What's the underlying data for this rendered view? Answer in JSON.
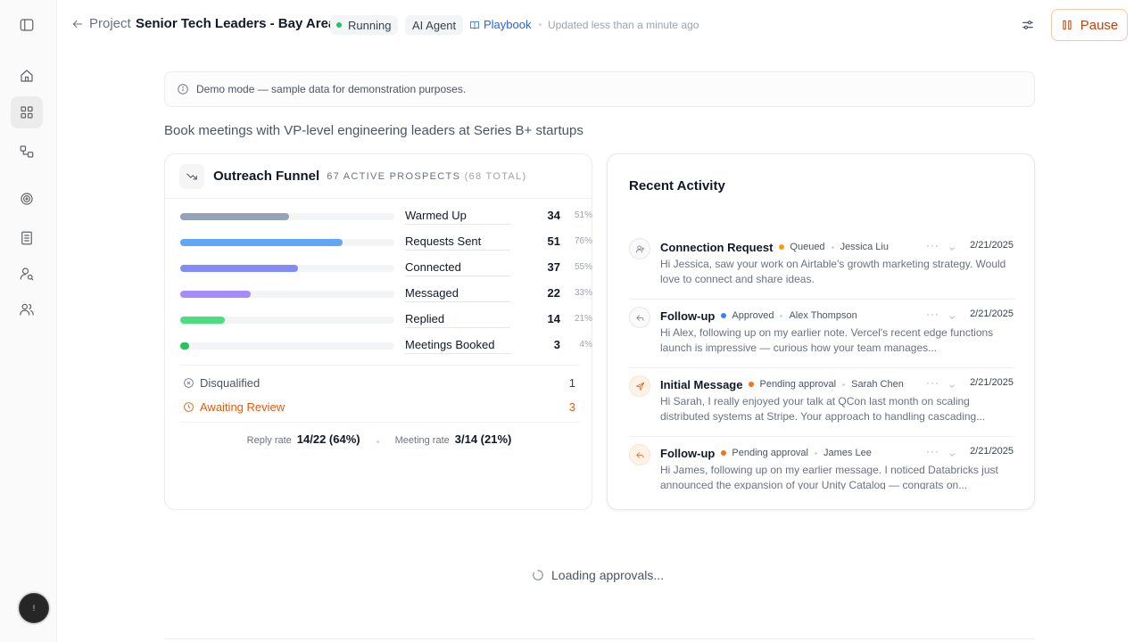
{
  "sidebar": {
    "icons": [
      "panel-toggle-icon",
      "home-icon",
      "grid-icon",
      "workflow-icon",
      "target-icon",
      "building-icon",
      "user-search-icon",
      "users-icon"
    ],
    "avatar_text": "!"
  },
  "header": {
    "back_label": "Project",
    "title": "Senior Tech Leaders - Bay Area",
    "status_badge": "Running",
    "agent_badge": "AI Agent",
    "playbook_link": "Playbook",
    "updated_text": "Updated less than a minute ago",
    "pause_label": "Pause"
  },
  "banner": {
    "text": "Demo mode — sample data for demonstration purposes."
  },
  "goal": "Book meetings with VP-level engineering leaders at Series B+ startups",
  "funnel": {
    "title": "Outreach Funnel",
    "active_text": "67 ACTIVE PROSPECTS",
    "total_text": "(68 TOTAL)",
    "stages": [
      {
        "label": "Warmed Up",
        "count": "34",
        "pct": "51%",
        "fraction": 0.51,
        "color": "#94a3b8"
      },
      {
        "label": "Requests Sent",
        "count": "51",
        "pct": "76%",
        "fraction": 0.76,
        "color": "#60a5fa"
      },
      {
        "label": "Connected",
        "count": "37",
        "pct": "55%",
        "fraction": 0.55,
        "color": "#818cf8"
      },
      {
        "label": "Messaged",
        "count": "22",
        "pct": "33%",
        "fraction": 0.33,
        "color": "#a78bfa"
      },
      {
        "label": "Replied",
        "count": "14",
        "pct": "21%",
        "fraction": 0.21,
        "color": "#4ade80"
      },
      {
        "label": "Meetings Booked",
        "count": "3",
        "pct": "4%",
        "fraction": 0.04,
        "color": "#22c55e"
      }
    ],
    "disqualified_label": "Disqualified",
    "disqualified_count": "1",
    "awaiting_label": "Awaiting Review",
    "awaiting_count": "3",
    "reply_rate_label": "Reply rate",
    "reply_rate_value": "14/22 (64%)",
    "meeting_rate_label": "Meeting rate",
    "meeting_rate_value": "3/14 (21%)"
  },
  "activity": {
    "title": "Recent Activity",
    "items": [
      {
        "type": "Connection Request",
        "status": "Queued",
        "status_color": "#f59e0b",
        "person": "Jessica Liu",
        "date": "2/21/2025",
        "icon": "user-plus-icon",
        "message": "Hi Jessica, saw your work on Airtable's growth marketing strategy. Would love to connect and share ideas."
      },
      {
        "type": "Follow-up",
        "status": "Approved",
        "status_color": "#3b82f6",
        "person": "Alex Thompson",
        "date": "2/21/2025",
        "icon": "reply-icon",
        "message": "Hi Alex, following up on my earlier note. Vercel's recent edge functions launch is impressive — curious how your team manages..."
      },
      {
        "type": "Initial Message",
        "status": "Pending approval",
        "status_color": "#f97316",
        "person": "Sarah Chen",
        "date": "2/21/2025",
        "icon": "send-icon",
        "message": "Hi Sarah, I really enjoyed your talk at QCon last month on scaling distributed systems at Stripe. Your approach to handling cascading..."
      },
      {
        "type": "Follow-up",
        "status": "Pending approval",
        "status_color": "#f97316",
        "person": "James Lee",
        "date": "2/21/2025",
        "icon": "reply-icon",
        "message": "Hi James, following up on my earlier message. I noticed Databricks just announced the expansion of your Unity Catalog — congrats on..."
      }
    ]
  },
  "loading_text": "Loading approvals..."
}
